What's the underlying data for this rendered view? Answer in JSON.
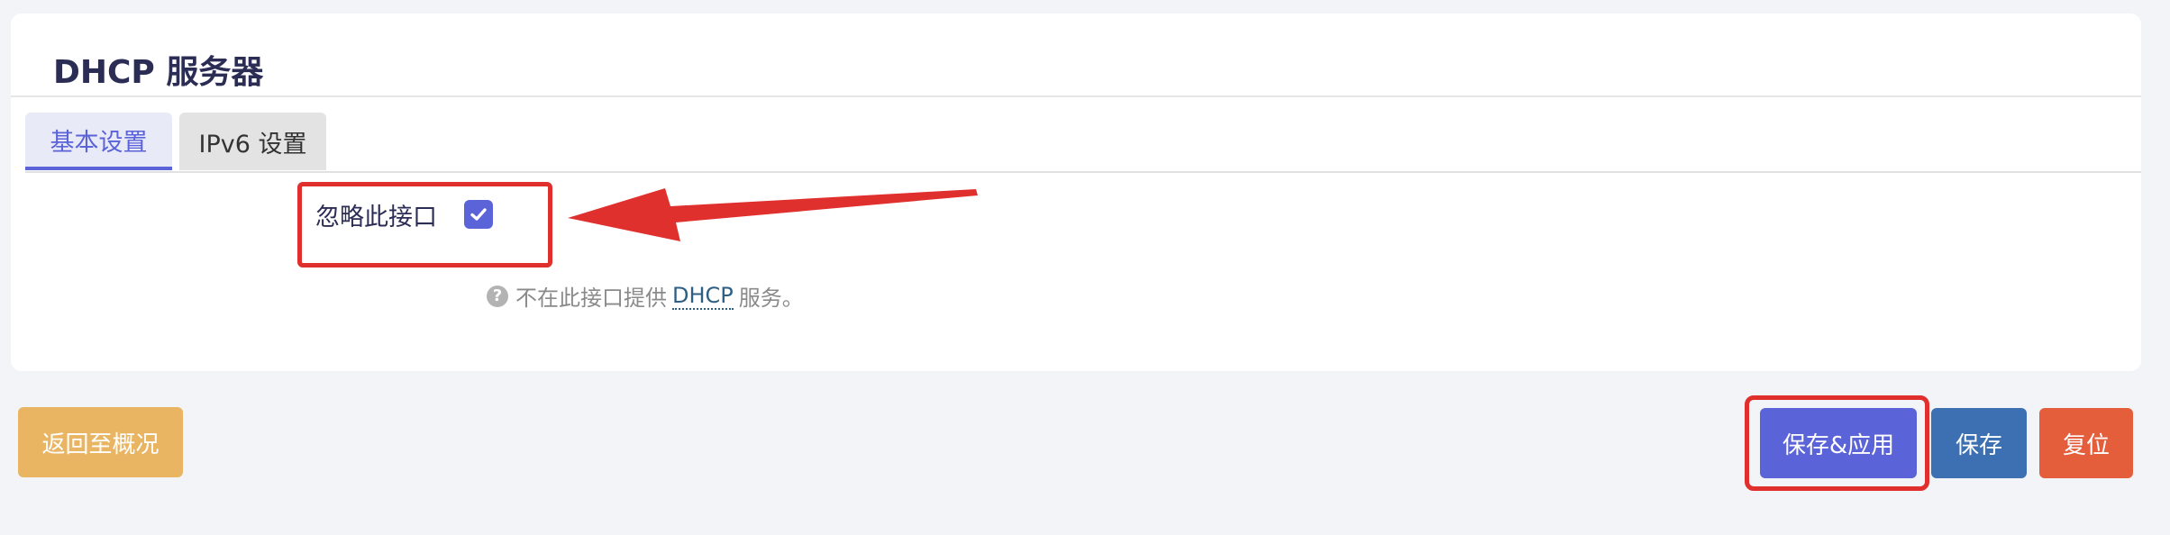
{
  "page": {
    "title": "DHCP 服务器"
  },
  "tabs": [
    {
      "label": "基本设置",
      "active": true
    },
    {
      "label": "IPv6 设置",
      "active": false
    }
  ],
  "field": {
    "label": "忽略此接口",
    "checked": true,
    "help_prefix": "不在此接口提供",
    "help_abbr": "DHCP",
    "help_suffix": "服务。"
  },
  "buttons": {
    "back": "返回至概况",
    "save_apply": "保存&应用",
    "save": "保存",
    "reset": "复位"
  },
  "colors": {
    "accent": "#5b63d8",
    "highlight": "#e0302d",
    "back": "#e9b562",
    "save": "#3d70b3",
    "reset": "#e45e3c"
  }
}
